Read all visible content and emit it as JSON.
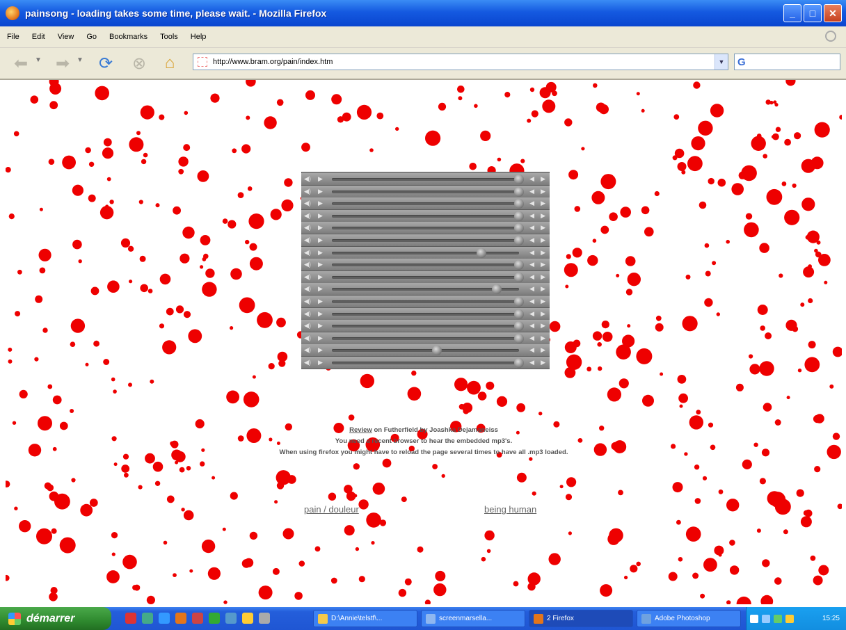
{
  "window": {
    "title": "painsong - loading takes some time, please wait. - Mozilla Firefox",
    "buttons": {
      "minimize": "_",
      "maximize": "□",
      "close": "✕"
    }
  },
  "menu": [
    "File",
    "Edit",
    "View",
    "Go",
    "Bookmarks",
    "Tools",
    "Help"
  ],
  "toolbar": {
    "url": "http://www.bram.org/pain/index.htm",
    "search_value": "",
    "search_engine": "G"
  },
  "players": {
    "count": 16,
    "controls": {
      "volume": "◀)",
      "play": "▶",
      "prev": "◀",
      "next": "▶"
    },
    "positions": [
      1,
      1,
      1,
      1,
      1,
      1,
      0.8,
      1,
      1,
      0.88,
      1,
      1,
      1,
      1,
      0.56,
      1
    ]
  },
  "info": {
    "review_link": "Review",
    "line1_rest": " on Futherfield by Joashka Dejamaneiss",
    "line2": "You need a recent browser to hear the embedded mp3's.",
    "line3": "When using firefox you might have to reload the page several times to have all .mp3 loaded."
  },
  "links": {
    "left": "pain / douleur",
    "right": "being human"
  },
  "colors": {
    "dot": "#ee0000",
    "player": "#8a8a8a",
    "xp_blue": "#245edb",
    "start_green": "#2f8a2f"
  },
  "taskbar": {
    "start_label": "démarrer",
    "quick_launch": [
      "browser-icon",
      "media-icon",
      "ie-icon",
      "firefox-icon",
      "app-icon",
      "network-icon",
      "window-icon",
      "tool-icon",
      "desktop-icon"
    ],
    "tasks": [
      {
        "label": "D:\\Annie\\telstf\\...",
        "icon": "folder-icon",
        "color": "#f5c94a"
      },
      {
        "label": "screenmarsella...",
        "icon": "image-icon",
        "color": "#8fb7f0"
      },
      {
        "label": "2 Firefox",
        "icon": "firefox-icon",
        "color": "#e4751a"
      },
      {
        "label": "Adobe Photoshop",
        "icon": "photoshop-icon",
        "color": "#6fa2e0"
      }
    ],
    "clock": "15:25"
  }
}
